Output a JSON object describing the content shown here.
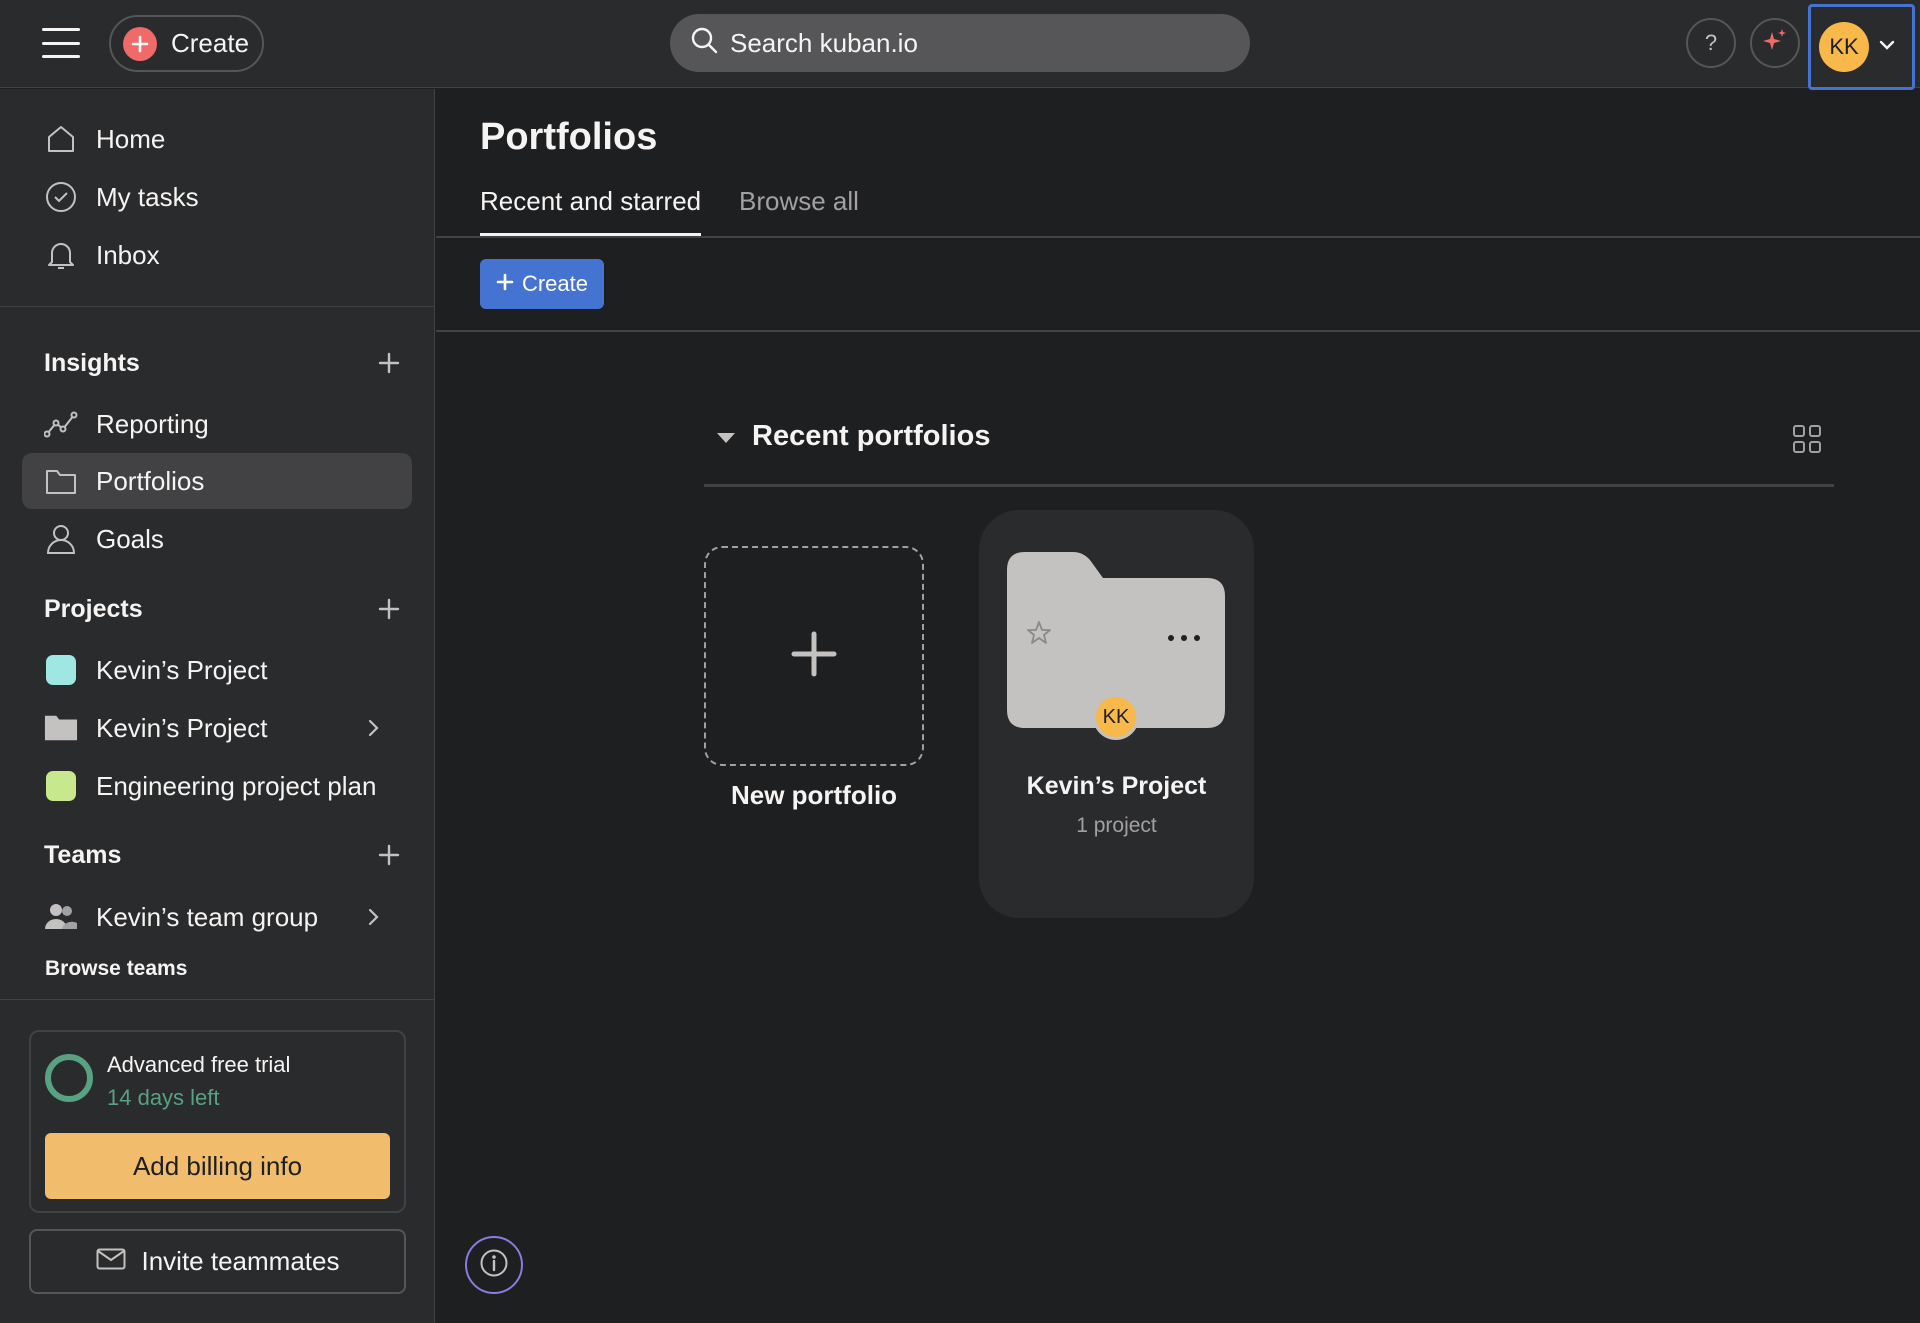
{
  "topbar": {
    "create_label": "Create",
    "search_placeholder": "Search kuban.io",
    "help_label": "?",
    "account_initials": "KK"
  },
  "sidebar": {
    "nav": [
      {
        "label": "Home",
        "icon": "home-icon"
      },
      {
        "label": "My tasks",
        "icon": "check-circle-icon"
      },
      {
        "label": "Inbox",
        "icon": "bell-icon"
      }
    ],
    "insights": {
      "title": "Insights",
      "items": [
        {
          "label": "Reporting",
          "icon": "reporting-icon"
        },
        {
          "label": "Portfolios",
          "icon": "folder-icon",
          "active": true
        },
        {
          "label": "Goals",
          "icon": "goals-icon"
        }
      ]
    },
    "projects": {
      "title": "Projects",
      "items": [
        {
          "label": "Kevin’s Project",
          "color": "#9ee7e3"
        },
        {
          "label": "Kevin’s Project",
          "icon": "folder-icon"
        },
        {
          "label": "Engineering project plan",
          "color": "#c7e88d"
        }
      ]
    },
    "teams": {
      "title": "Teams",
      "items": [
        {
          "label": "Kevin’s team group",
          "icon": "team-icon"
        }
      ],
      "browse_label": "Browse teams"
    },
    "trial": {
      "title": "Advanced free trial",
      "days_left": "14 days left",
      "button": "Add billing info"
    },
    "invite_label": "Invite teammates"
  },
  "main": {
    "title": "Portfolios",
    "tabs": [
      {
        "label": "Recent and starred",
        "active": true
      },
      {
        "label": "Browse all",
        "active": false
      }
    ],
    "create_label": "Create",
    "recent": {
      "title": "Recent portfolios",
      "new_label": "New portfolio",
      "cards": [
        {
          "title": "Kevin’s Project",
          "subtitle": "1 project",
          "owner_initials": "KK"
        }
      ]
    }
  },
  "colors": {
    "accent": "#4573d2",
    "create_red": "#f06a6a",
    "avatar": "#f8b84a",
    "trial_green": "#58a182",
    "billing": "#f1bd6c"
  }
}
